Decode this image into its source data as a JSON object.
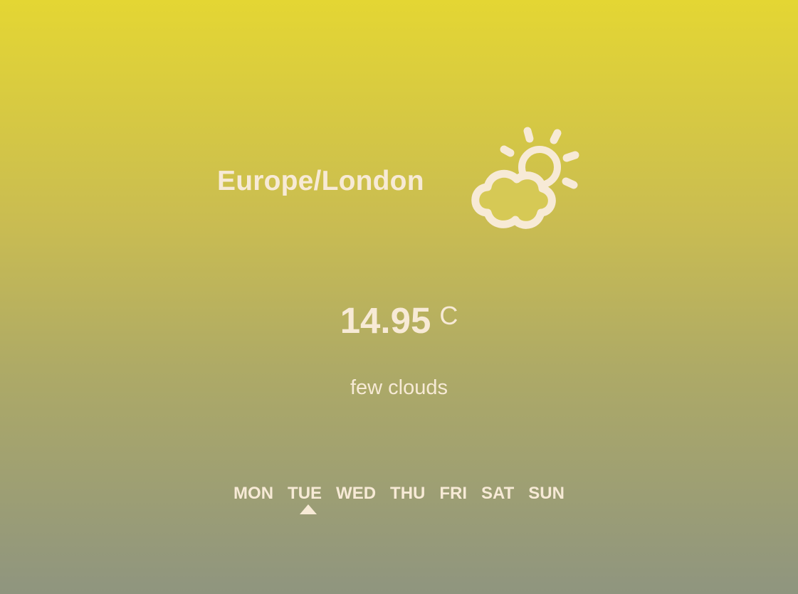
{
  "location": {
    "name": "Europe/London"
  },
  "current": {
    "temperature": "14.95",
    "unit": "C",
    "description": "few clouds",
    "icon": "sun-behind-cloud-icon"
  },
  "days": [
    {
      "label": "MON",
      "active": false
    },
    {
      "label": "TUE",
      "active": true
    },
    {
      "label": "WED",
      "active": false
    },
    {
      "label": "THU",
      "active": false
    },
    {
      "label": "FRI",
      "active": false
    },
    {
      "label": "SAT",
      "active": false
    },
    {
      "label": "SUN",
      "active": false
    }
  ],
  "colors": {
    "gradient_top": "#e4d633",
    "gradient_bottom": "#8f957f",
    "foreground": "#f7ead6"
  }
}
